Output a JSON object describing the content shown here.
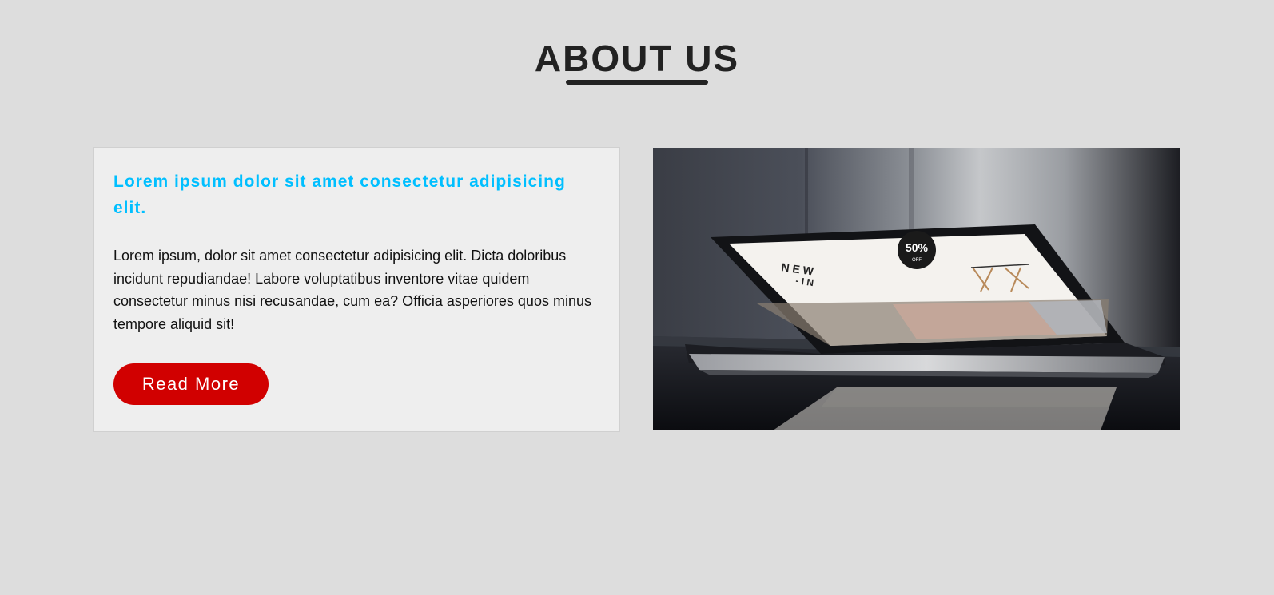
{
  "section": {
    "title": "ABOUT US"
  },
  "about": {
    "heading": "Lorem ipsum dolor sit amet consectetur adipisicing elit.",
    "body": "Lorem ipsum, dolor sit amet consectetur adipisicing elit. Dicta doloribus incidunt repudiandae! Labore voluptatibus inventore vitae quidem consectetur minus nisi recusandae, cum ea? Officia asperiores quos minus tempore aliquid sit!",
    "button_label": "Read More"
  },
  "image": {
    "subject": "laptop-photo",
    "screen_text_1": "N E W",
    "screen_text_2": "- I N",
    "badge_text": "50%",
    "badge_sub": "OFF"
  },
  "colors": {
    "background": "#dddddd",
    "card": "#eeeeee",
    "heading_accent": "#00bfff",
    "button": "#d10000",
    "title": "#222222"
  }
}
